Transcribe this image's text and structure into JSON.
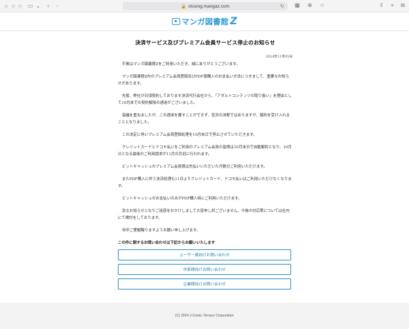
{
  "browser": {
    "url": "closing.mangaz.com"
  },
  "site": {
    "logo_text": "マンガ図書館",
    "logo_z": "Z"
  },
  "article": {
    "title": "決済サービス及びプレミアム会員サービス停止のお知らせ",
    "date": "2024年11月05日",
    "paragraphs": [
      "平素はマンガ図書館Zをご利用いただき、誠にありがとうございます。",
      "マンガ図書館Z内のプレミアム会員登録及びPDF版購入のお支払い方法につきまして、重要なお知らせがあります。",
      "先般、弊社が日頃契約しております決済代行会社から、「アダルトコンテンツの取り扱い」を理由として10月末での契約解除の通達がございました。",
      "協議を重ねましたが、この通達を覆すことができず、苦渋の決断ではありますが、解約を受け入れることとなりました。",
      "この決定に伴いプレミアム会員登録処理を10月末日で停止させていただきます。",
      "クレジットカードとドコモ払いをご利用のプレミアム会員の皆様は10月末日で自動解約となり、10月分となる最後のご利用請求が11月の月初に行われます。",
      "ビットキャッシュのプレミアム会員様は先払いいただいた月数分ご利用いただけます。",
      "またPDF購入に伴う決済処理も11日よりクレジットカード、ドコモ払いはご利用いただけなくなります。",
      "ビットキャッシュのお支払いのみがPDF購入時にご利用いただけます。",
      "急なお知らせとなりご迷惑をおかけしまして大変申し訳ございません。今後の対応策については社内にて検討をしております。",
      "何卒ご理解賜りますようお願い申し上げます。"
    ]
  },
  "contact": {
    "heading": "この件に関するお問い合わせは下記からお願いいたします",
    "buttons": [
      "ユーザー様向けお問い合わせ",
      "作家様向けお問い合わせ",
      "企業様向けお問い合わせ"
    ]
  },
  "footer": {
    "copyright": "(C) 2024 J-Comic Terrace Corporation"
  }
}
